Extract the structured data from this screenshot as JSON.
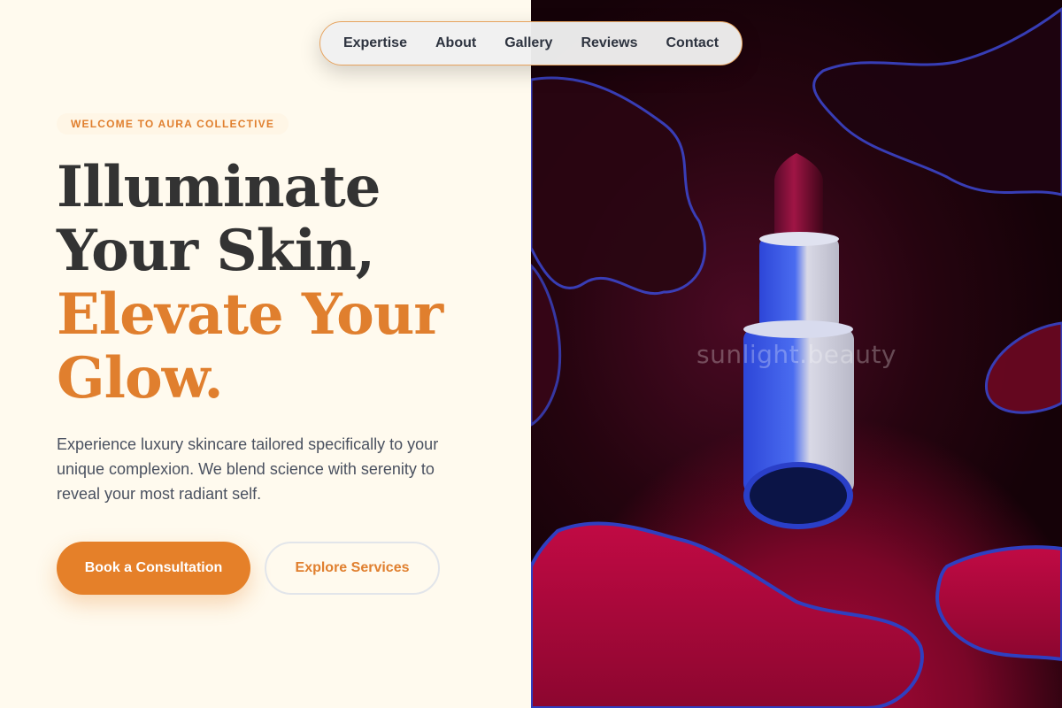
{
  "nav": {
    "items": [
      "Expertise",
      "About",
      "Gallery",
      "Reviews",
      "Contact"
    ]
  },
  "hero": {
    "eyebrow": "WELCOME TO AURA COLLECTIVE",
    "headline_line1": "Illuminate",
    "headline_line2": "Your Skin,",
    "headline_line3": "Elevate Your",
    "headline_line4": "Glow.",
    "description": "Experience luxury skincare tailored specifically to your unique complexion. We blend science with serenity to reveal your most radiant self.",
    "primary_cta": "Book a Consultation",
    "secondary_cta": "Explore Services"
  },
  "image": {
    "watermark": "sunlight.beauty",
    "subject": "lipstick-on-red-liquid"
  },
  "colors": {
    "accent": "#e07f2e",
    "primary_button": "#e58029",
    "heading_dark": "#333333",
    "body_text": "#4a5160",
    "page_background": "#fffaee"
  }
}
